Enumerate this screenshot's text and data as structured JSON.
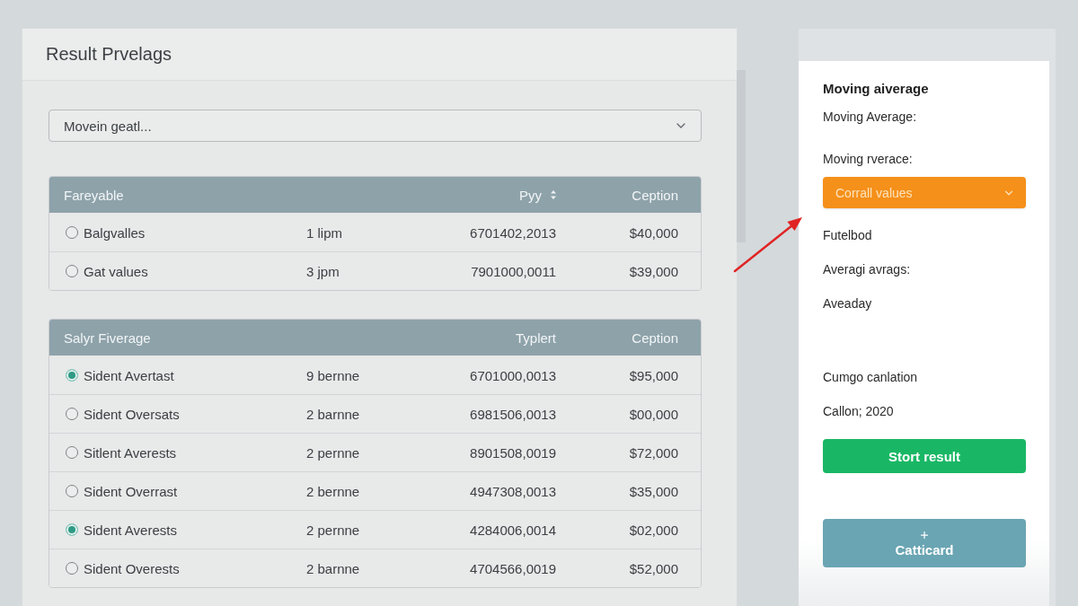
{
  "main_panel": {
    "title": "Result Prvelags",
    "dropdown": {
      "value": "Movein geatl..."
    },
    "tables": [
      {
        "columns": [
          {
            "label": "Fareyable"
          },
          null,
          {
            "label": "Pyy",
            "sortable": true
          },
          {
            "label": "Ception"
          }
        ],
        "rows": [
          {
            "selected": false,
            "cells": [
              "Balgvalles",
              "1 lipm",
              "6701402,2013",
              "$40,000"
            ]
          },
          {
            "selected": false,
            "cells": [
              "Gat values",
              "3 jpm",
              "7901000,0011",
              "$39,000"
            ]
          }
        ]
      },
      {
        "columns": [
          {
            "label": "Salyr Fiverage"
          },
          null,
          {
            "label": "Typlert"
          },
          {
            "label": "Ception"
          }
        ],
        "rows": [
          {
            "selected": true,
            "cells": [
              "Sident Avertast",
              "9 bernne",
              "6701000,0013",
              "$95,000"
            ]
          },
          {
            "selected": false,
            "cells": [
              "Sident Oversats",
              "2 barnne",
              "6981506,0013",
              "$00,000"
            ]
          },
          {
            "selected": false,
            "cells": [
              "Sitlent Averests",
              "2 pernne",
              "8901508,0019",
              "$72,000"
            ]
          },
          {
            "selected": false,
            "cells": [
              "Sident Overrast",
              "2 bernne",
              "4947308,0013",
              "$35,000"
            ]
          },
          {
            "selected": true,
            "cells": [
              "Sident Averests",
              "2 pernne",
              "4284006,0014",
              "$02,000"
            ]
          },
          {
            "selected": false,
            "cells": [
              "Sident Overests",
              "2 barnne",
              "4704566,0019",
              "$52,000"
            ]
          }
        ]
      }
    ]
  },
  "settings_panel": {
    "sections": [
      {
        "items": [
          {
            "kind": "heading",
            "text": "Moving aiverage"
          },
          {
            "kind": "label",
            "text": "Moving Average:"
          }
        ]
      },
      {
        "items": [
          {
            "kind": "label",
            "text": "Moving rverace:"
          },
          {
            "kind": "select",
            "text": "Corrall values"
          },
          {
            "kind": "label",
            "text": "Futelbod"
          },
          {
            "kind": "label",
            "text": "Averagi avrags:"
          },
          {
            "kind": "label",
            "text": "Aveaday"
          }
        ]
      },
      {
        "items": [
          {
            "kind": "label",
            "text": "Cumgo canlation"
          },
          {
            "kind": "label",
            "text": "Callon; 2020"
          },
          {
            "kind": "action",
            "text": "Stort result"
          }
        ]
      },
      {
        "items": [
          {
            "kind": "add",
            "text": "Catticard"
          }
        ]
      }
    ]
  }
}
